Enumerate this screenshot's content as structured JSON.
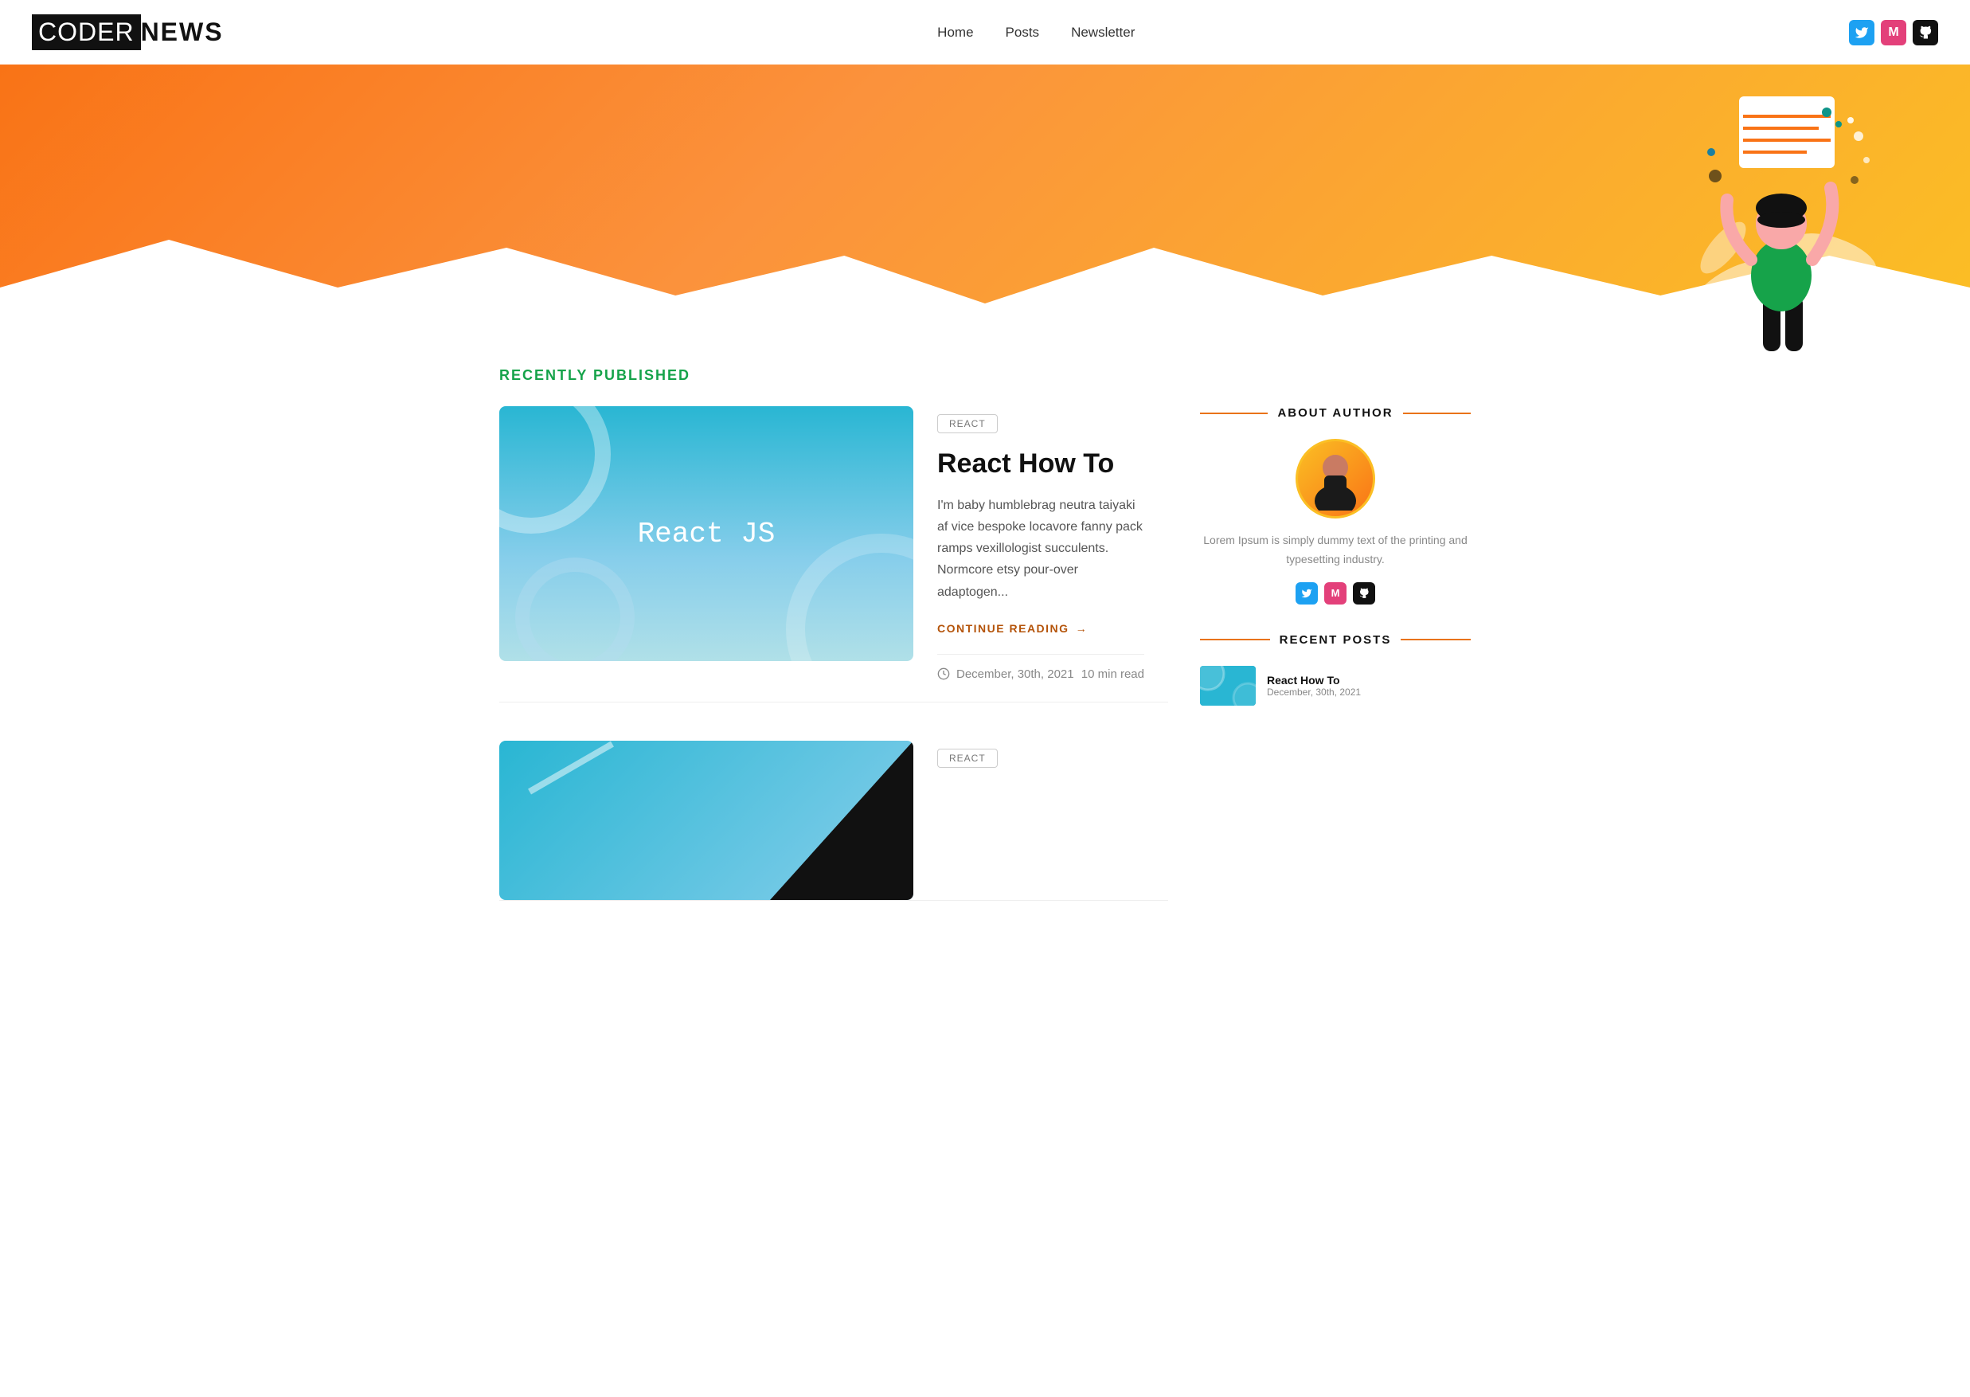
{
  "site": {
    "logo_coder": "CODER",
    "logo_news": "NEWS"
  },
  "nav": {
    "items": [
      {
        "label": "Home",
        "href": "#"
      },
      {
        "label": "Posts",
        "href": "#"
      },
      {
        "label": "Newsletter",
        "href": "#"
      }
    ]
  },
  "social": {
    "twitter_label": "T",
    "medium_label": "M",
    "github_label": "G"
  },
  "recently_published": {
    "label": "RECENTLY PUBLISHED"
  },
  "posts": [
    {
      "tag": "REACT",
      "title": "React How To",
      "excerpt": "I'm baby humblebrag neutra taiyaki af vice bespoke locavore fanny pack ramps vexillologist succulents. Normcore etsy pour-over adaptogen...",
      "continue_reading": "CONTINUE READING",
      "date": "December, 30th, 2021",
      "read_time": "10 min read",
      "image_title": "React  JS"
    },
    {
      "tag": "REACT",
      "title": "",
      "excerpt": "",
      "continue_reading": "",
      "date": "",
      "read_time": "",
      "image_title": ""
    }
  ],
  "sidebar": {
    "about_author": {
      "title": "ABOUT AUTHOR",
      "bio": "Lorem Ipsum is simply dummy text of the printing and typesetting industry."
    },
    "recent_posts": {
      "title": "RECENT POSTS",
      "items": [
        {
          "title": "React How To",
          "date": "December, 30th, 2021"
        }
      ]
    }
  }
}
